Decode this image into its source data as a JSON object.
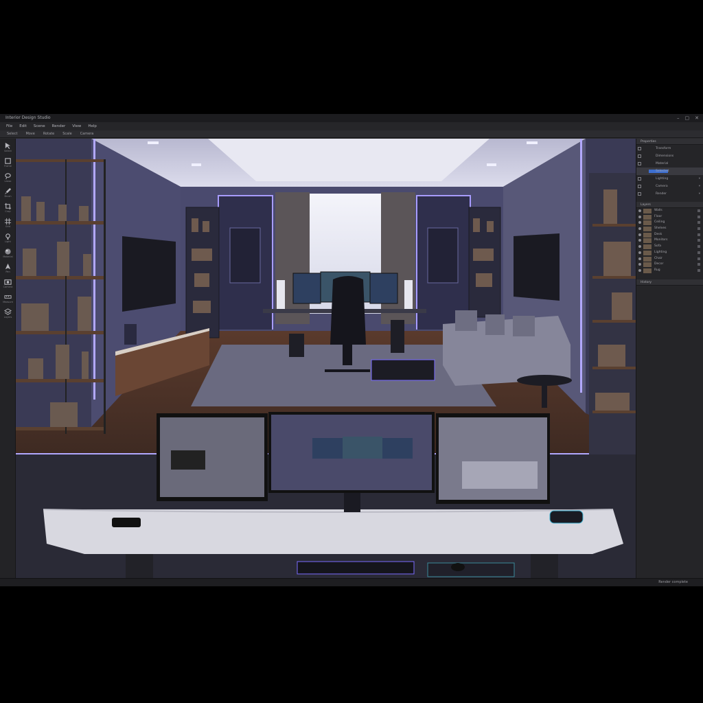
{
  "window": {
    "title": "Interior Design Studio",
    "controls": [
      "–",
      "▢",
      "✕"
    ]
  },
  "menus": [
    "File",
    "Edit",
    "Scene",
    "Render",
    "View",
    "Help"
  ],
  "toolbar": [
    "Select",
    "Move",
    "Rotate",
    "Scale",
    "Camera"
  ],
  "tools": [
    {
      "icon": "select-icon",
      "label": "Select"
    },
    {
      "icon": "frame-icon",
      "label": "Frame"
    },
    {
      "icon": "lasso-icon",
      "label": "Lasso"
    },
    {
      "icon": "brush-icon",
      "label": "Brush"
    },
    {
      "icon": "crop-icon",
      "label": "Crop"
    },
    {
      "icon": "grid-icon",
      "label": "Grid"
    },
    {
      "icon": "light-icon",
      "label": "Light"
    },
    {
      "icon": "material-icon",
      "label": "Material"
    },
    {
      "icon": "pen-icon",
      "label": "Pen"
    },
    {
      "icon": "camera-icon",
      "label": "Camera"
    },
    {
      "icon": "measure-icon",
      "label": "Measure"
    },
    {
      "icon": "layers-icon",
      "label": "Layers"
    }
  ],
  "panels": {
    "properties": {
      "title": "Properties",
      "rows": [
        "Transform",
        "Dimensions",
        "Material",
        "Selected",
        "Lighting",
        "Camera",
        "Render"
      ]
    },
    "layers": {
      "title": "Layers",
      "items": [
        "Walls",
        "Floor",
        "Ceiling",
        "Shelves",
        "Desk",
        "Monitors",
        "Sofa",
        "Lighting",
        "Chair",
        "Decor",
        "Rug"
      ]
    },
    "extra": {
      "title": "History"
    }
  },
  "status": {
    "text": "Render complete"
  },
  "colors": {
    "accent": "#3d6fd0",
    "led": "#7a6cff",
    "panel": "#252528"
  }
}
